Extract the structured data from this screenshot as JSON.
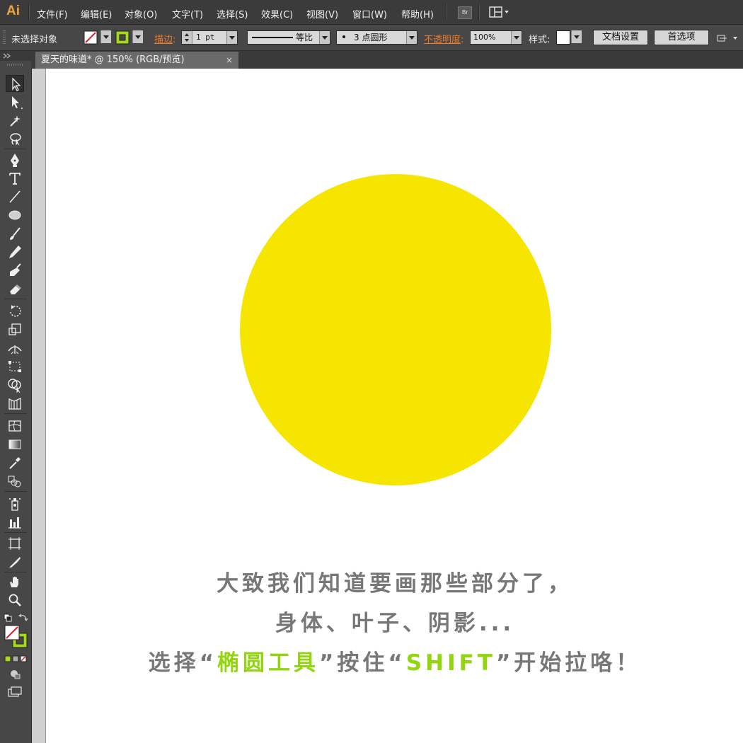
{
  "app": {
    "logo": "Ai"
  },
  "menu": [
    "文件(F)",
    "编辑(E)",
    "对象(O)",
    "文字(T)",
    "选择(S)",
    "效果(C)",
    "视图(V)",
    "窗口(W)",
    "帮助(H)"
  ],
  "bridge_button": "Br",
  "control_bar": {
    "selection_status": "未选择对象",
    "stroke_label": "描边",
    "stroke_weight": "1 pt",
    "stroke_profile": "等比",
    "brush": "3 点圆形",
    "opacity_label": "不透明度",
    "opacity_value": "100%",
    "style_label": "样式:",
    "document_setup": "文档设置",
    "preferences": "首选项"
  },
  "document_tab": {
    "title": "夏天的味道* @ 150% (RGB/预览)",
    "close": "×"
  },
  "artboard": {
    "circle_color": "#f5e500",
    "caption_line1": "大致我们知道要画那些部分了，",
    "caption_line2": "身体、叶子、阴影...",
    "caption_line3_a": "选择“",
    "caption_line3_highlight1": "椭圆工具",
    "caption_line3_b": "”按住“",
    "caption_line3_highlight2": "SHIFT",
    "caption_line3_c": "”开始拉咯！",
    "caption_color": "#777777",
    "highlight_color": "#93d60f"
  },
  "colors": {
    "fill_none_slash": "#e02020",
    "stroke_swatch": "#a6d81e",
    "accent_orange": "#ea7b2b"
  },
  "tools": [
    "selection-tool",
    "direct-selection-tool",
    "magic-wand-tool",
    "lasso-tool",
    "pen-tool",
    "type-tool",
    "line-segment-tool",
    "ellipse-tool",
    "paintbrush-tool",
    "pencil-tool",
    "blob-brush-tool",
    "eraser-tool",
    "rotate-tool",
    "scale-tool",
    "width-tool",
    "free-transform-tool",
    "shape-builder-tool",
    "perspective-grid-tool",
    "mesh-tool",
    "gradient-tool",
    "eyedropper-tool",
    "blend-tool",
    "symbol-sprayer-tool",
    "column-graph-tool",
    "artboard-tool",
    "slice-tool",
    "hand-tool",
    "zoom-tool"
  ]
}
